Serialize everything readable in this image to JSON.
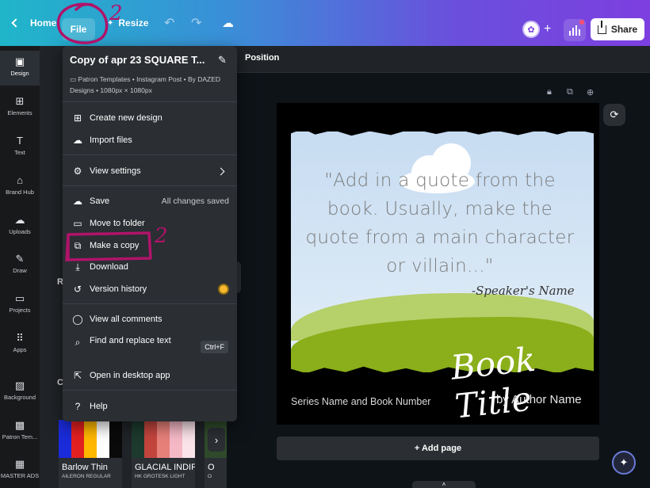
{
  "topbar": {
    "home_label": "Home",
    "file_label": "File",
    "resize_label": "Resize",
    "share_label": "Share",
    "avatar_icon": "butterfly-icon"
  },
  "rail": {
    "items": [
      {
        "label": "Design",
        "icon": "design-icon"
      },
      {
        "label": "Elements",
        "icon": "elements-icon"
      },
      {
        "label": "Text",
        "icon": "text-icon"
      },
      {
        "label": "Brand Hub",
        "icon": "brand-hub-icon"
      },
      {
        "label": "Uploads",
        "icon": "uploads-icon"
      },
      {
        "label": "Draw",
        "icon": "draw-icon"
      },
      {
        "label": "Projects",
        "icon": "projects-icon"
      },
      {
        "label": "Apps",
        "icon": "apps-icon"
      },
      {
        "label": "Background",
        "icon": "background-icon"
      },
      {
        "label": "Patron Tem...",
        "icon": "patron-templates-icon"
      },
      {
        "label": "MASTER ADS",
        "icon": "master-ads-icon"
      }
    ]
  },
  "panel": {
    "letter_r": "R",
    "letter_c": "C",
    "palettes": [
      {
        "name": "Barlow Thin",
        "sub": "AILERON REGULAR",
        "colors": [
          "#1a2bd9",
          "#e32020",
          "#ffb800",
          "#ffffff",
          "#0a0a0a"
        ]
      },
      {
        "name": "GLACIAL INDIF",
        "sub": "HK GROTESK LIGHT",
        "colors": [
          "#1d3a2e",
          "#c2453d",
          "#e8807a",
          "#f5b9c6",
          "#fbe3ea"
        ]
      },
      {
        "name": "O",
        "sub": "O",
        "colors": [
          "#2f4a2a"
        ]
      }
    ]
  },
  "toolbar": {
    "position_label": "Position"
  },
  "menu": {
    "title": "Copy of apr 23 SQUARE T...",
    "meta": "Patron Templates • Instagram Post • By DAZED Designs • 1080px × 1080px",
    "items": {
      "create": "Create new design",
      "import": "Import files",
      "view_settings": "View settings",
      "save": "Save",
      "save_status": "All changes saved",
      "move": "Move to folder",
      "copy": "Make a copy",
      "download": "Download",
      "history": "Version history",
      "comments": "View all comments",
      "find": "Find and replace text",
      "find_shortcut": "Ctrl+F",
      "desktop": "Open in desktop app",
      "help": "Help"
    }
  },
  "design": {
    "quote": "\"Add in a quote from the book. Usually, make the quote from a main character or villain...\"",
    "speaker": "-Speaker's Name",
    "book_title": "Book Title",
    "series": "Series Name and Book Number",
    "author": "by Author Name"
  },
  "canvas": {
    "add_page": "+ Add page"
  },
  "annotations": {
    "mark_1": "2",
    "mark_2": "2",
    "accent_color": "#b0136a"
  }
}
